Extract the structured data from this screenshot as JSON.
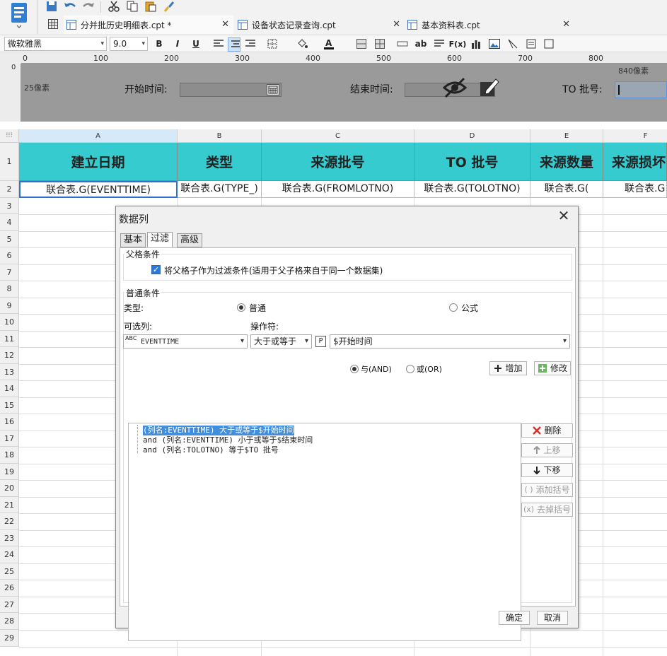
{
  "toolbar": {
    "icons": [
      "save-icon",
      "undo-icon",
      "redo-icon",
      "cut-icon",
      "copy-icon",
      "paste-icon",
      "format-brush-icon"
    ]
  },
  "tabs": [
    {
      "label": "分并批历史明细表.cpt *"
    },
    {
      "label": "设备状态记录查询.cpt"
    },
    {
      "label": "基本资料表.cpt"
    }
  ],
  "format": {
    "font_family": "微软雅黑",
    "font_size": "9.0",
    "bold": "B",
    "italic": "I",
    "underline": "U"
  },
  "ruler": {
    "ticks": [
      "0",
      "100",
      "200",
      "300",
      "400",
      "500",
      "600",
      "700",
      "800"
    ],
    "px_label": "840像素",
    "left_label": "25像素"
  },
  "design_params": {
    "start_label": "开始时间:",
    "end_label": "结束时间:",
    "to_label": "TO  批号:"
  },
  "sheet": {
    "corner": "⁝⁝⁝",
    "columns": [
      "A",
      "B",
      "C",
      "D",
      "E",
      "F"
    ],
    "rows": [
      "1",
      "2",
      "3",
      "4",
      "5",
      "6",
      "7",
      "8",
      "9",
      "10",
      "11",
      "12",
      "13",
      "14",
      "15",
      "16",
      "17",
      "18",
      "19",
      "20",
      "21",
      "22",
      "23",
      "24",
      "25",
      "26",
      "27",
      "28",
      "29"
    ],
    "header_cells": [
      "建立日期",
      "类型",
      "来源批号",
      "TO 批号",
      "来源数量",
      "来源损坏"
    ],
    "data_cells": [
      "联合表.G(EVENTTIME)",
      "联合表.G(TYPE_)",
      "联合表.G(FROMLOTNO)",
      "联合表.G(TOLOTNO)",
      "联合表.G(",
      "联合表.G"
    ]
  },
  "dialog": {
    "title": "数据列",
    "close": "✕",
    "tabs": [
      "基本",
      "过滤",
      "高级"
    ],
    "parent_group": "父格条件",
    "parent_checkbox": "将父格子作为过滤条件(适用于父子格来自于同一个数据集)",
    "normal_group": "普通条件",
    "type_label": "类型:",
    "type_normal": "普通",
    "type_formula": "公式",
    "column_label": "可选列:",
    "operator_label": "操作符:",
    "column_value": "EVENTTIME",
    "column_icon": "ABC",
    "operator_value": "大于或等于",
    "param_badge": "P",
    "value_text": "$开始时间",
    "and_label": "与(AND)",
    "or_label": "或(OR)",
    "add_button": "增加",
    "modify_button": "修改",
    "conditions": [
      "(列名:EVENTTIME) 大于或等于$开始时间",
      "and (列名:EVENTTIME) 小于或等于$结束时间",
      "and (列名:TOLOTNO) 等于$TO 批号"
    ],
    "delete_button": "删除",
    "up_button": "上移",
    "down_button": "下移",
    "add_bracket_button": "添加括号",
    "remove_bracket_button": "去掉括号",
    "ok_button": "确定",
    "cancel_button": "取消"
  },
  "colors": {
    "header_fill": "#35cbcf",
    "selection": "#3f8ee0",
    "design_bg": "#9a9a9a"
  }
}
